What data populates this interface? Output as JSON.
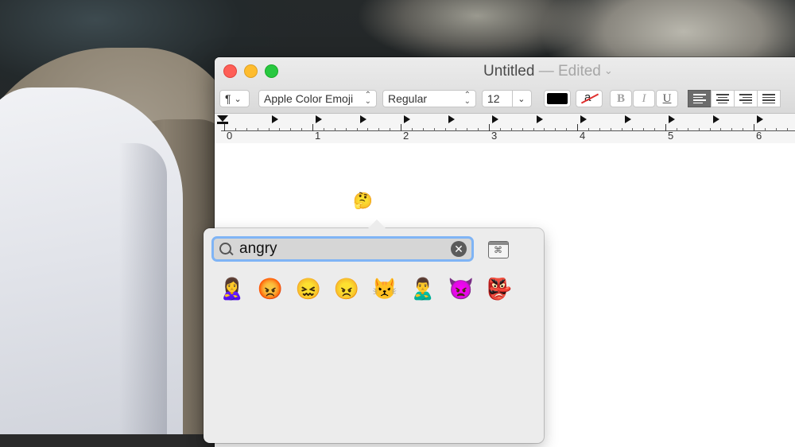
{
  "window": {
    "title": "Untitled",
    "edited_label": "— Edited",
    "title_chevron": "⌄"
  },
  "toolbar": {
    "paragraph_icon": "¶",
    "paragraph_chevron": "⌄",
    "font_family": "Apple Color Emoji",
    "font_style": "Regular",
    "font_size": "12",
    "size_chevron": "⌄",
    "bg_color_glyph": "a",
    "bold": "B",
    "italic": "I",
    "underline": "U",
    "text_color": "#000000"
  },
  "ruler": {
    "numbers": [
      "0",
      "1",
      "2",
      "3",
      "4",
      "5",
      "6"
    ]
  },
  "document": {
    "inserted_emoji": "🤔"
  },
  "emoji_picker": {
    "search_value": "angry",
    "clear_glyph": "✕",
    "viewer_glyph": "⌘",
    "results": [
      "🙎‍♀️",
      "😡",
      "😖",
      "😠",
      "😾",
      "🙎‍♂️",
      "👿",
      "👺"
    ]
  },
  "colors": {
    "close": "#fe5f57",
    "minimize": "#febc2e",
    "zoom": "#28c840",
    "search_focus": "#7fb4f5"
  }
}
